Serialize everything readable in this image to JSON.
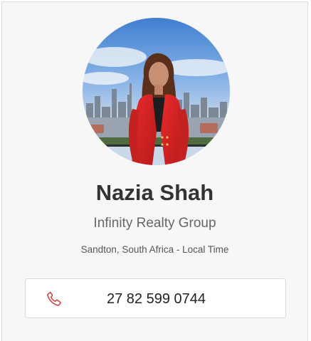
{
  "profile": {
    "name": "Nazia Shah",
    "company": "Infinity Realty Group",
    "location": "Sandton, South Africa - Local Time",
    "photo_alt": "Profile photo"
  },
  "contact": {
    "phone": "27 82 599 0744",
    "phone_icon": "phone-icon"
  },
  "colors": {
    "card_bg": "#f7f7f7",
    "accent_red": "#d32f2f",
    "name_text": "#333333",
    "subtle_text": "#666666"
  }
}
